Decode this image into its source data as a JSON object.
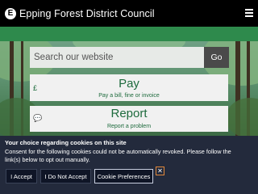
{
  "header": {
    "title": "Epping Forest District Council",
    "logo_letter": "E"
  },
  "search": {
    "placeholder": "Search our website",
    "button_label": "Go"
  },
  "cards": {
    "pay": {
      "title": "Pay",
      "subtitle": "Pay a bill, fine or invoice",
      "icon": "£"
    },
    "report": {
      "title": "Report",
      "subtitle": "Report a problem",
      "icon": "💬"
    }
  },
  "cookie_banner": {
    "heading": "Your choice regarding cookies on this site",
    "text": "Consent for the following cookies could not be automatically revoked. Please follow the link(s) below to opt out manually.",
    "accept_label": "I Accept",
    "reject_label": "I Do Not Accept",
    "preferences_label": "Cookie Preferences",
    "close_symbol": "✕"
  },
  "colors": {
    "header_bg": "#000000",
    "brand_green": "#2e8a4c",
    "banner_bg": "#232a3c",
    "focus_outline": "#e3893b"
  }
}
